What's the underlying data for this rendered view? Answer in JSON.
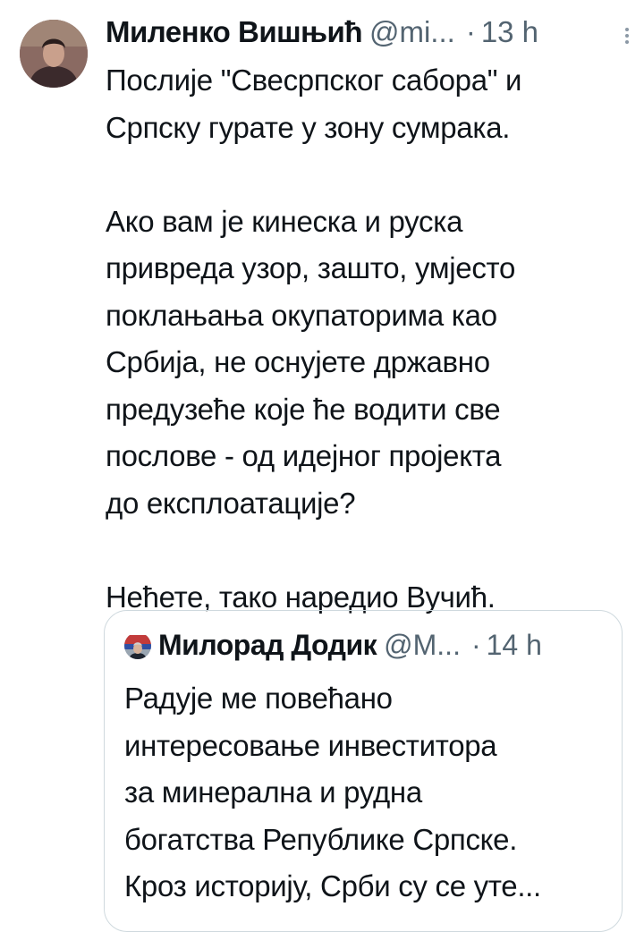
{
  "tweet": {
    "author": {
      "name": "Миленко Вишњић",
      "handle": "@mi...",
      "avatar_icon": "profile-photo-icon"
    },
    "separator": "·",
    "time": "13 h",
    "menu_icon": "more-vertical-icon",
    "text_lines": [
      "Послије \"Свесрпског сабора\" и",
      "Српску  гурате у зону сумрака.",
      "Ако вам је кинеска и руска",
      "привреда узор, зашто, умјесто",
      "поклањања окупаторима као",
      "Србија, не оснујете државно",
      "предузеће које ће водити све",
      "послове - од идејног пројекта",
      "до експлоатације?",
      "Нећете, тако наредио Вучић."
    ]
  },
  "quoted_tweet": {
    "author": {
      "name": "Милорад Додик",
      "handle": "@M...",
      "avatar_icon": "profile-photo-icon"
    },
    "separator": "·",
    "time": "14 h",
    "text_lines": [
      "Радује ме повећано",
      "интересовање инвеститора",
      "за минерална и рудна",
      "богатства Републике Српске.",
      "Кроз историју, Срби су се уте..."
    ]
  },
  "colors": {
    "text_primary": "#0f1419",
    "text_secondary": "#536471",
    "border": "#cfd9de"
  }
}
